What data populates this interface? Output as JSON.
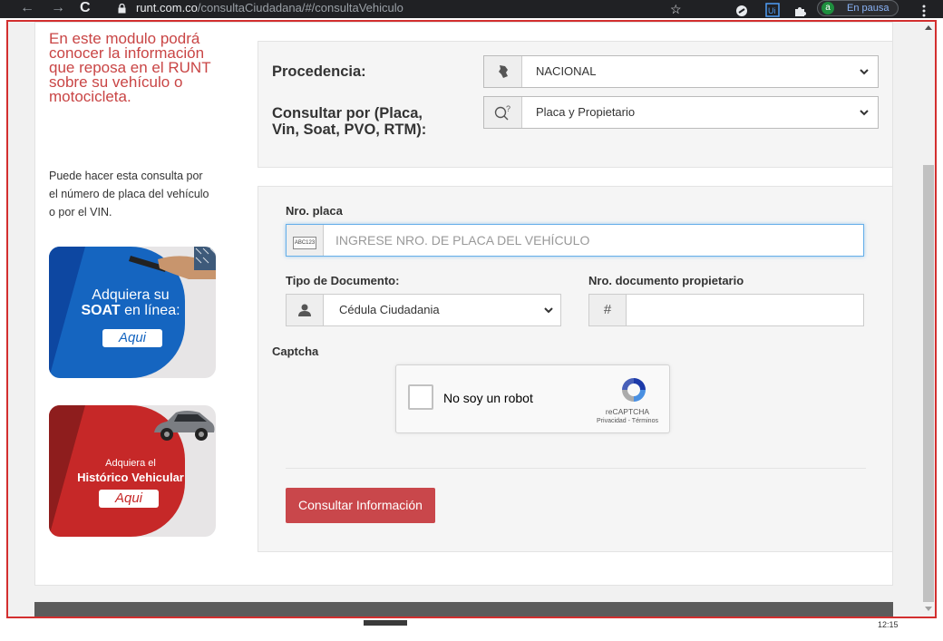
{
  "browser": {
    "url_host": "runt.com.co",
    "url_path": "/consultaCiudadana/#/consultaVehiculo",
    "nav_back": "←",
    "nav_forward": "→",
    "reload": "C",
    "star": "☆",
    "profile_initial": "a",
    "profile_status": "En pausa"
  },
  "left": {
    "intro": "En este modulo podrá conocer la información que reposa en el RUNT sobre su vehículo o motocicleta.",
    "help": "Puede hacer esta consulta por el número de placa del vehículo o por el VIN.",
    "soat_banner": {
      "line1": "Adquiera su",
      "bold": "SOAT",
      "line2": "en línea:",
      "cta": "Aqui"
    },
    "historico_banner": {
      "line1": "Adquiera el",
      "bold": "Histórico Vehicular",
      "cta": "Aqui"
    }
  },
  "search": {
    "procedencia_label": "Procedencia:",
    "procedencia_value": "NACIONAL",
    "consultar_label_1": "Consultar por (Placa,",
    "consultar_label_2": "Vin, Soat, PVO, RTM):",
    "consultar_value": "Placa y Propietario"
  },
  "form": {
    "placa_label": "Nro. placa",
    "placa_icon_text": "ABC123",
    "placa_placeholder": "INGRESE NRO. DE PLACA DEL VEHÍCULO",
    "tipo_doc_label": "Tipo de Documento:",
    "tipo_doc_value": "Cédula Ciudadania",
    "nro_doc_label": "Nro. documento propietario",
    "nro_doc_addon": "#",
    "captcha_label": "Captcha",
    "captcha_text": "No soy un robot",
    "captcha_brand": "reCAPTCHA",
    "captcha_links": "Privacidad - Términos",
    "submit": "Consultar Información"
  },
  "taskbar": {
    "clock": "12:15"
  }
}
